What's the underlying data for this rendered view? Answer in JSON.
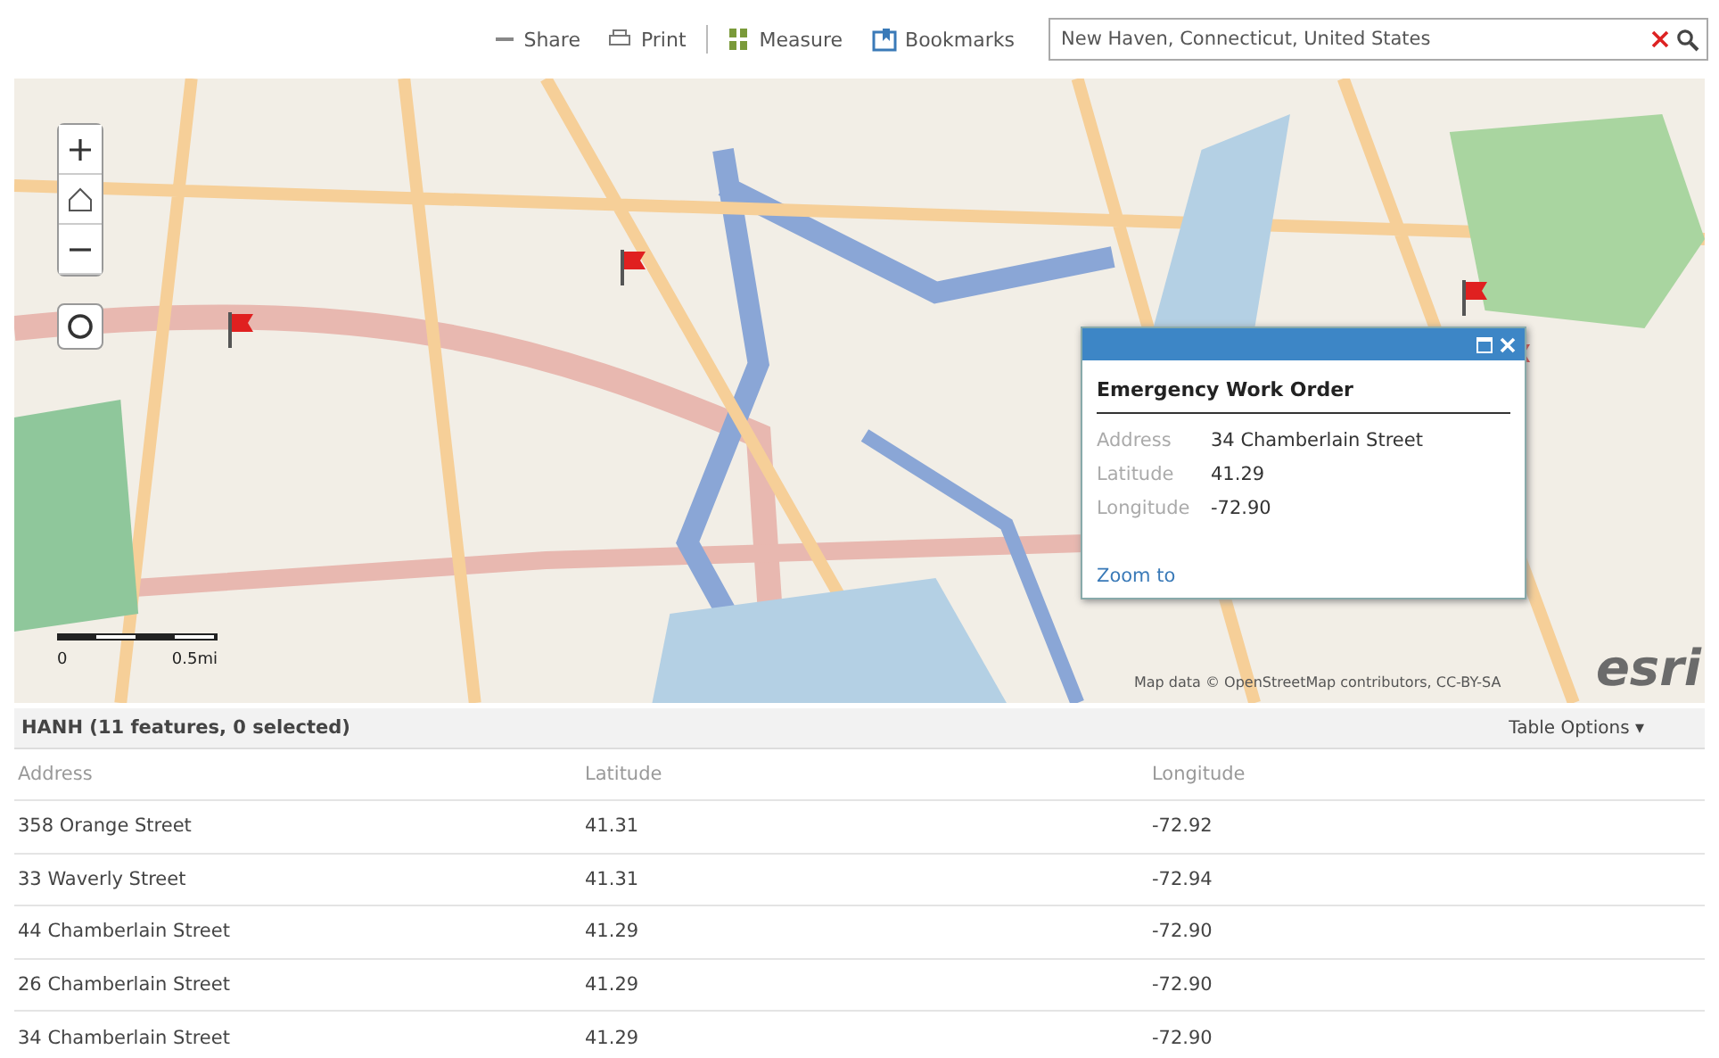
{
  "toolbar": {
    "items": [
      {
        "kind": "share",
        "label": "Share"
      },
      {
        "kind": "print",
        "label": "Print"
      },
      {
        "kind": "measure",
        "label": "Measure"
      },
      {
        "kind": "bookmarks",
        "label": "Bookmarks"
      }
    ],
    "search": {
      "value": "New Haven, Connecticut, United States"
    }
  },
  "map": {
    "attribution": "Map data © OpenStreetMap contributors, CC-BY-SA",
    "logo": "esri",
    "scale_labels": [
      "0",
      "0.5mi"
    ],
    "popup": {
      "title": "Emergency Work Order",
      "fields": [
        {
          "label": "Address",
          "value": "34 Chamberlain Street"
        },
        {
          "label": "Latitude",
          "value": "41.29"
        },
        {
          "label": "Longitude",
          "value": "-72.90"
        }
      ],
      "link": "Zoom to"
    }
  },
  "table": {
    "title": "HANH (11 features, 0 selected)",
    "options": "Table Options ▾",
    "columns": [
      "Address",
      "Latitude",
      "Longitude"
    ],
    "rows": [
      [
        "358 Orange Street",
        "41.31",
        "-72.92"
      ],
      [
        "33 Waverly Street",
        "41.31",
        "-72.94"
      ],
      [
        "44 Chamberlain Street",
        "41.29",
        "-72.90"
      ],
      [
        "26 Chamberlain Street",
        "41.29",
        "-72.90"
      ],
      [
        "34 Chamberlain Street",
        "41.29",
        "-72.90"
      ]
    ]
  }
}
